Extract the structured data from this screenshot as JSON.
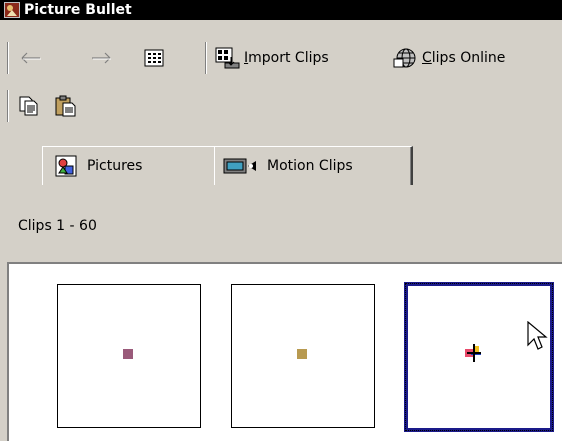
{
  "window": {
    "title": "Picture Bullet",
    "icon": "picture-bullet-app-icon"
  },
  "toolbar": {
    "back_icon": "back-arrow-icon",
    "forward_icon": "forward-arrow-icon",
    "view_icon": "grid-view-icon",
    "import_label_accel": "I",
    "import_label_rest": "mport Clips",
    "import_icon": "import-clips-icon",
    "online_label_accel": "C",
    "online_label_rest": "lips Online",
    "online_icon": "clips-online-icon",
    "copy_icon": "copy-icon",
    "paste_icon": "paste-icon"
  },
  "tabs": [
    {
      "label": "Pictures",
      "icon": "pictures-icon",
      "active": true
    },
    {
      "label": "Motion Clips",
      "icon": "motion-clips-icon",
      "active": false
    }
  ],
  "clips_count": "Clips 1 - 60",
  "clips": [
    {
      "name": "clip-1",
      "color": "#9a5a7a",
      "selected": false
    },
    {
      "name": "clip-2",
      "color": "#b89a50",
      "selected": false
    },
    {
      "name": "clip-3",
      "color": "multicolor",
      "selected": true
    }
  ],
  "colors": {
    "face": "#d4d0c8",
    "selection_border": "#1a1a8a",
    "titlebar": "#000000"
  }
}
